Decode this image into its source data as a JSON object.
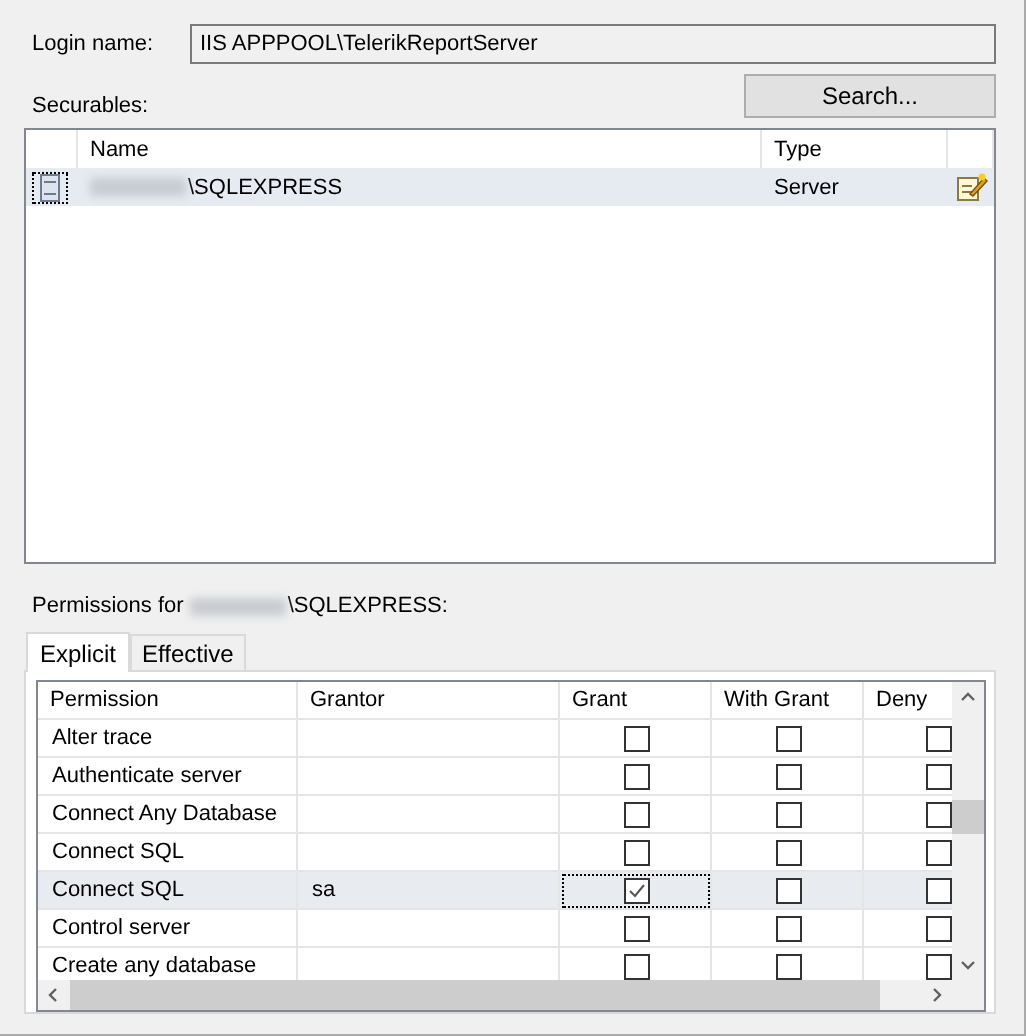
{
  "login": {
    "label": "Login name:",
    "value": "IIS APPPOOL\\TelerikReportServer"
  },
  "securables": {
    "label": "Securables:",
    "search_button": "Search...",
    "columns": [
      "Name",
      "Type"
    ],
    "rows": [
      {
        "name": "\\SQLEXPRESS",
        "type": "Server",
        "selected": true
      }
    ]
  },
  "permissions": {
    "label_prefix": "Permissions for",
    "label_suffix": "\\SQLEXPRESS:",
    "tabs": [
      {
        "label": "Explicit",
        "selected": true
      },
      {
        "label": "Effective",
        "selected": false
      }
    ],
    "columns": [
      "Permission",
      "Grantor",
      "Grant",
      "With Grant",
      "Deny"
    ],
    "rows": [
      {
        "permission": "Alter trace",
        "grantor": "",
        "grant": false,
        "with_grant": false,
        "deny": false,
        "selected": false
      },
      {
        "permission": "Authenticate server",
        "grantor": "",
        "grant": false,
        "with_grant": false,
        "deny": false,
        "selected": false
      },
      {
        "permission": "Connect Any Database",
        "grantor": "",
        "grant": false,
        "with_grant": false,
        "deny": false,
        "selected": false
      },
      {
        "permission": "Connect SQL",
        "grantor": "",
        "grant": false,
        "with_grant": false,
        "deny": false,
        "selected": false
      },
      {
        "permission": "Connect SQL",
        "grantor": "sa",
        "grant": true,
        "with_grant": false,
        "deny": false,
        "selected": true
      },
      {
        "permission": "Control server",
        "grantor": "",
        "grant": false,
        "with_grant": false,
        "deny": false,
        "selected": false
      },
      {
        "permission": "Create any database",
        "grantor": "",
        "grant": false,
        "with_grant": false,
        "deny": false,
        "selected": false
      }
    ]
  }
}
